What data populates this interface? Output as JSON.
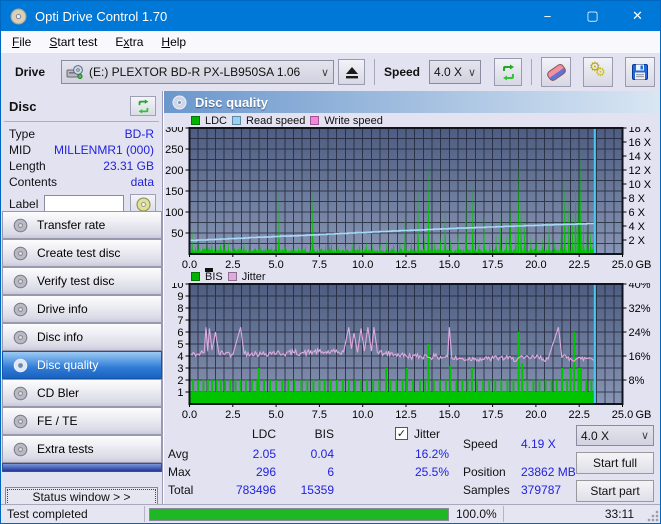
{
  "window": {
    "title": "Opti Drive Control 1.70",
    "minimize": "−",
    "maximize": "▢",
    "close": "✕"
  },
  "menubar": {
    "items": [
      {
        "label": "File",
        "accel": 0
      },
      {
        "label": "Start test",
        "accel": 0
      },
      {
        "label": "Extra",
        "accel": 1
      },
      {
        "label": "Help",
        "accel": 0
      }
    ]
  },
  "toolbar": {
    "drive_label": "Drive",
    "drive_value": "(E:)   PLEXTOR BD-R   PX-LB950SA 1.06",
    "speed_label": "Speed",
    "speed_value": "4.0 X",
    "icons": [
      "drive-icon",
      "eject-icon",
      "refresh-icon",
      "eraser-icon",
      "gears-icon",
      "save-icon"
    ]
  },
  "disc_panel": {
    "title": "Disc",
    "fields": [
      {
        "label": "Type",
        "value": "BD-R"
      },
      {
        "label": "MID",
        "value": "MILLENMR1 (000)"
      },
      {
        "label": "Length",
        "value": "23.31 GB"
      },
      {
        "label": "Contents",
        "value": "data"
      }
    ],
    "label_field": {
      "label": "Label",
      "value": ""
    }
  },
  "sidebar": {
    "items": [
      {
        "label": "Transfer rate",
        "selected": false
      },
      {
        "label": "Create test disc",
        "selected": false
      },
      {
        "label": "Verify test disc",
        "selected": false
      },
      {
        "label": "Drive info",
        "selected": false
      },
      {
        "label": "Disc info",
        "selected": false
      },
      {
        "label": "Disc quality",
        "selected": true
      },
      {
        "label": "CD Bler",
        "selected": false
      },
      {
        "label": "FE / TE",
        "selected": false
      },
      {
        "label": "Extra tests",
        "selected": false
      }
    ],
    "status_window_button": "Status window > >"
  },
  "main": {
    "header": "Disc quality"
  },
  "chart_data": [
    {
      "type": "area",
      "name": "ldc-read-speed-chart",
      "x_unit": "GB",
      "xlim": [
        0,
        25
      ],
      "x_ticks": [
        "0.0",
        "2.5",
        "5.0",
        "7.5",
        "10.0",
        "12.5",
        "15.0",
        "17.5",
        "20.0",
        "22.5",
        "25.0"
      ],
      "left_axis": {
        "lim": [
          0,
          300
        ],
        "ticks": [
          "300",
          "250",
          "200",
          "150",
          "100",
          "50"
        ],
        "tick_values": [
          300,
          250,
          200,
          150,
          100,
          50
        ]
      },
      "right_axis": {
        "lim": [
          0,
          18
        ],
        "ticks": [
          "18 X",
          "16 X",
          "14 X",
          "12 X",
          "10 X",
          "8 X",
          "6 X",
          "4 X",
          "2 X"
        ],
        "tick_values": [
          18,
          16,
          14,
          12,
          10,
          8,
          6,
          4,
          2
        ]
      },
      "grid": {
        "v_step": 0.5,
        "h_step": 25
      },
      "legend": [
        {
          "label": "LDC",
          "color": "#00b400"
        },
        {
          "label": "Read speed",
          "color": "#96d2f6"
        },
        {
          "label": "Write speed",
          "color": "#f484dc"
        }
      ],
      "end_x": 23.4,
      "ldc_baseline": 8,
      "ldc_spikes": [
        [
          0.15,
          62
        ],
        [
          0.35,
          20
        ],
        [
          0.55,
          30
        ],
        [
          0.75,
          18
        ],
        [
          0.95,
          25
        ],
        [
          1.15,
          20
        ],
        [
          1.3,
          38
        ],
        [
          1.55,
          16
        ],
        [
          1.8,
          22
        ],
        [
          2.05,
          32
        ],
        [
          2.25,
          30
        ],
        [
          2.6,
          16
        ],
        [
          2.9,
          20
        ],
        [
          3.15,
          28
        ],
        [
          3.45,
          22
        ],
        [
          3.8,
          14
        ],
        [
          4.1,
          20
        ],
        [
          4.4,
          16
        ],
        [
          4.75,
          18
        ],
        [
          5.15,
          155
        ],
        [
          5.5,
          18
        ],
        [
          5.9,
          14
        ],
        [
          6.3,
          18
        ],
        [
          6.7,
          22
        ],
        [
          7.1,
          155
        ],
        [
          7.5,
          20
        ],
        [
          7.85,
          26
        ],
        [
          8.2,
          46
        ],
        [
          8.6,
          22
        ],
        [
          9.0,
          26
        ],
        [
          9.4,
          30
        ],
        [
          9.8,
          22
        ],
        [
          10.2,
          32
        ],
        [
          10.6,
          26
        ],
        [
          11.0,
          24
        ],
        [
          11.4,
          38
        ],
        [
          11.8,
          30
        ],
        [
          12.15,
          34
        ],
        [
          12.45,
          118
        ],
        [
          12.8,
          48
        ],
        [
          13.2,
          160
        ],
        [
          13.55,
          42
        ],
        [
          13.8,
          228
        ],
        [
          14.15,
          38
        ],
        [
          14.5,
          46
        ],
        [
          14.75,
          130
        ],
        [
          15.1,
          42
        ],
        [
          15.5,
          56
        ],
        [
          15.95,
          205
        ],
        [
          16.35,
          175
        ],
        [
          16.7,
          38
        ],
        [
          17.0,
          92
        ],
        [
          17.35,
          34
        ],
        [
          17.7,
          52
        ],
        [
          17.95,
          96
        ],
        [
          18.3,
          48
        ],
        [
          18.55,
          122
        ],
        [
          18.85,
          84
        ],
        [
          19.0,
          232
        ],
        [
          19.15,
          142
        ],
        [
          19.35,
          92
        ],
        [
          19.7,
          48
        ],
        [
          20.05,
          36
        ],
        [
          20.4,
          42
        ],
        [
          20.75,
          96
        ],
        [
          21.1,
          38
        ],
        [
          21.45,
          58
        ],
        [
          21.65,
          182
        ],
        [
          21.9,
          132
        ],
        [
          22.1,
          104
        ],
        [
          22.3,
          295
        ],
        [
          22.45,
          162
        ],
        [
          22.6,
          255
        ],
        [
          22.75,
          92
        ],
        [
          22.95,
          74
        ],
        [
          23.15,
          62
        ],
        [
          23.3,
          46
        ]
      ],
      "read_speed": [
        [
          0,
          1.95
        ],
        [
          1.2,
          2.05
        ],
        [
          2.4,
          2.2
        ],
        [
          3.6,
          2.35
        ],
        [
          4.9,
          2.5
        ],
        [
          6.2,
          2.62
        ],
        [
          7.5,
          2.78
        ],
        [
          8.9,
          2.95
        ],
        [
          10.3,
          3.1
        ],
        [
          11.7,
          3.28
        ],
        [
          13.1,
          3.42
        ],
        [
          14.5,
          3.58
        ],
        [
          15.9,
          3.72
        ],
        [
          17.3,
          3.85
        ],
        [
          18.7,
          3.98
        ],
        [
          20.1,
          4.1
        ],
        [
          21.5,
          4.22
        ],
        [
          22.8,
          4.32
        ],
        [
          23.4,
          4.36
        ]
      ]
    },
    {
      "type": "bar+line",
      "name": "bis-jitter-chart",
      "x_unit": "GB",
      "xlim": [
        0,
        25
      ],
      "x_ticks": [
        "0.0",
        "2.5",
        "5.0",
        "7.5",
        "10.0",
        "12.5",
        "15.0",
        "17.5",
        "20.0",
        "22.5",
        "25.0"
      ],
      "left_axis": {
        "lim": [
          0,
          10
        ],
        "ticks": [
          "10",
          "9",
          "8",
          "7",
          "6",
          "5",
          "4",
          "3",
          "2",
          "1"
        ],
        "tick_values": [
          10,
          9,
          8,
          7,
          6,
          5,
          4,
          3,
          2,
          1
        ]
      },
      "right_axis": {
        "lim": [
          0,
          40
        ],
        "ticks": [
          "40%",
          "32%",
          "24%",
          "16%",
          "8%"
        ],
        "tick_values": [
          40,
          32,
          24,
          16,
          8
        ]
      },
      "grid": {
        "v_step": 0.5,
        "h_step": 1
      },
      "legend": [
        {
          "label": "BIS",
          "color": "#00b400"
        },
        {
          "label": "Jitter",
          "color": "#dfaade"
        }
      ],
      "end_x": 23.4,
      "bis_baseline": 1,
      "bis_spikes_2": [
        0.2,
        0.5,
        0.8,
        1.05,
        1.3,
        1.55,
        1.8,
        2.05,
        2.35,
        2.65,
        2.95,
        3.25,
        3.6,
        3.9,
        4.3,
        4.65,
        5.0,
        5.35,
        5.7,
        6.05,
        6.45,
        6.8,
        7.15,
        7.5,
        7.8,
        8.15,
        8.5,
        8.85,
        9.2,
        9.55,
        9.9,
        10.25,
        10.6,
        10.95,
        11.6,
        11.95,
        12.3,
        12.9,
        13.3,
        13.6,
        14.1,
        14.45,
        14.8,
        15.4,
        15.75,
        16.05,
        16.6,
        16.95,
        17.3,
        17.65,
        18.0,
        18.35,
        18.7,
        19.5,
        19.85,
        20.2,
        20.55,
        20.9,
        21.2,
        21.8,
        22.9,
        23.2
      ],
      "bis_spikes": [
        [
          4.0,
          3
        ],
        [
          11.35,
          3
        ],
        [
          12.55,
          3
        ],
        [
          13.8,
          5
        ],
        [
          15.05,
          3.2
        ],
        [
          16.3,
          3
        ],
        [
          19.0,
          6
        ],
        [
          19.2,
          3.4
        ],
        [
          21.5,
          3
        ],
        [
          22.0,
          3
        ],
        [
          22.2,
          6
        ],
        [
          22.45,
          3
        ],
        [
          22.6,
          3
        ]
      ],
      "jitter_points": [
        [
          0,
          4.1
        ],
        [
          0.5,
          4.15
        ],
        [
          0.85,
          4.3
        ],
        [
          0.95,
          6.4
        ],
        [
          1.05,
          4.4
        ],
        [
          1.15,
          6.3
        ],
        [
          1.3,
          4.5
        ],
        [
          1.5,
          6.0
        ],
        [
          1.7,
          4.2
        ],
        [
          2.1,
          4.3
        ],
        [
          2.5,
          4.1
        ],
        [
          2.95,
          6.4
        ],
        [
          3.15,
          4.2
        ],
        [
          3.6,
          4.25
        ],
        [
          4.2,
          4.15
        ],
        [
          4.8,
          4.3
        ],
        [
          5.4,
          4.2
        ],
        [
          6.0,
          4.3
        ],
        [
          6.6,
          4.25
        ],
        [
          7.2,
          4.35
        ],
        [
          7.8,
          4.3
        ],
        [
          8.4,
          4.3
        ],
        [
          8.9,
          4.35
        ],
        [
          9.2,
          6.4
        ],
        [
          9.35,
          4.6
        ],
        [
          9.5,
          5.9
        ],
        [
          9.7,
          4.3
        ],
        [
          9.9,
          6.3
        ],
        [
          10.1,
          4.4
        ],
        [
          10.3,
          6.4
        ],
        [
          10.5,
          4.4
        ],
        [
          10.65,
          6.4
        ],
        [
          10.85,
          4.3
        ],
        [
          11.3,
          4.2
        ],
        [
          11.9,
          4.15
        ],
        [
          12.5,
          4.0
        ],
        [
          13.1,
          3.95
        ],
        [
          13.7,
          4.0
        ],
        [
          14.3,
          3.9
        ],
        [
          14.9,
          3.95
        ],
        [
          15.0,
          6.4
        ],
        [
          15.15,
          3.8
        ],
        [
          15.8,
          3.75
        ],
        [
          16.5,
          3.8
        ],
        [
          17.2,
          3.75
        ],
        [
          17.9,
          3.85
        ],
        [
          18.6,
          3.75
        ],
        [
          19.3,
          3.8
        ],
        [
          20.0,
          3.9
        ],
        [
          20.7,
          3.75
        ],
        [
          21.3,
          6.4
        ],
        [
          21.5,
          3.9
        ],
        [
          22.0,
          3.8
        ],
        [
          22.6,
          3.75
        ],
        [
          23.1,
          3.85
        ],
        [
          23.4,
          3.7
        ]
      ]
    }
  ],
  "stats": {
    "col_headers": {
      "ldc": "LDC",
      "bis": "BIS"
    },
    "jitter_checkbox": {
      "label": "Jitter",
      "checked": true,
      "check": "✓"
    },
    "rows": [
      {
        "label": "Avg",
        "ldc": "2.05",
        "bis": "0.04",
        "jitter": "16.2%"
      },
      {
        "label": "Max",
        "ldc": "296",
        "bis": "6",
        "jitter": "25.5%"
      },
      {
        "label": "Total",
        "ldc": "783496",
        "bis": "15359",
        "jitter": ""
      }
    ],
    "speed_label": "Speed",
    "speed_value": "4.19 X",
    "position_label": "Position",
    "position_value": "23862 MB",
    "samples_label": "Samples",
    "samples_value": "379787",
    "speed_select": "4.0 X",
    "start_full": "Start full",
    "start_part": "Start part"
  },
  "statusbar": {
    "status": "Test completed",
    "percent": "100.0%",
    "time": "33:11",
    "progress_value": 100
  },
  "colors": {
    "titlebar": "#0078d7",
    "chart_bg_top": "#4d5c80",
    "chart_bg_bottom": "#8895b4",
    "grid": "#1c2133",
    "ldc_green": "#00c400",
    "read_speed_blue": "#a6d9f7",
    "jitter_pink": "#dfaade",
    "end_marker": "#4ac8f4",
    "value_blue": "#2222dd",
    "progress_green": "#1fb825"
  }
}
